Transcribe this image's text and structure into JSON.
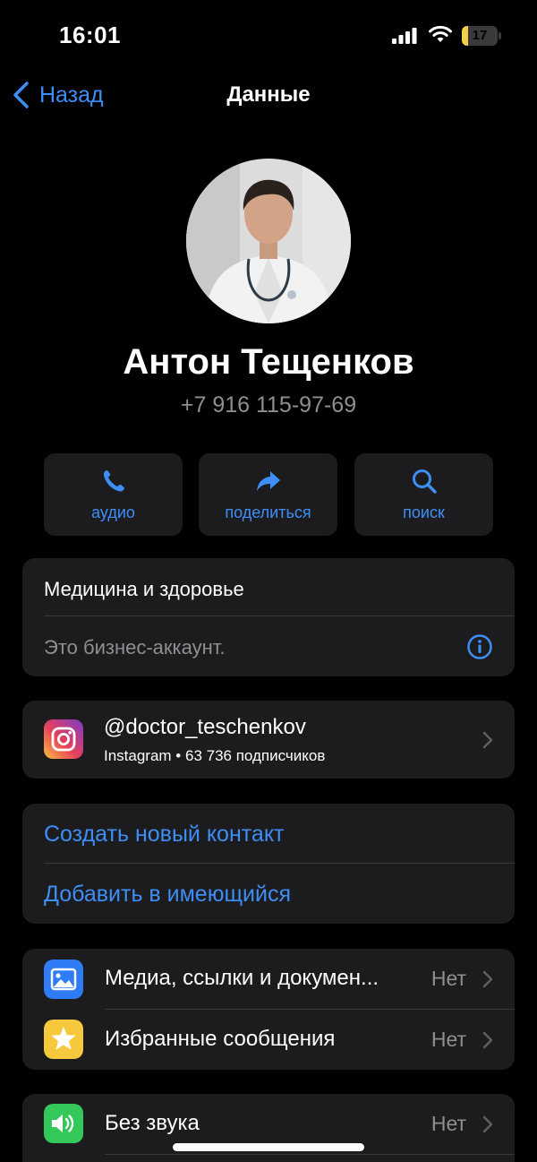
{
  "status_bar": {
    "time": "16:01",
    "battery_level": "17",
    "battery_fraction": 0.17
  },
  "nav": {
    "back_label": "Назад",
    "title": "Данные"
  },
  "profile": {
    "name": "Антон Тещенков",
    "phone": "+7 916 115-97-69"
  },
  "actions": [
    {
      "icon": "phone-icon",
      "label": "аудио"
    },
    {
      "icon": "share-arrow-icon",
      "label": "поделиться"
    },
    {
      "icon": "search-icon",
      "label": "поиск"
    }
  ],
  "business": {
    "category": "Медицина и здоровье",
    "note": "Это бизнес-аккаунт."
  },
  "instagram": {
    "handle": "@doctor_teschenkov",
    "meta": "Instagram • 63 736 подписчиков"
  },
  "contact_actions": {
    "create": "Создать новый контакт",
    "add_existing": "Добавить в имеющийся"
  },
  "media_section": {
    "media": {
      "label": "Медиа, ссылки и докумен...",
      "value": "Нет"
    },
    "starred": {
      "label": "Избранные сообщения",
      "value": "Нет"
    }
  },
  "mute_section": {
    "mute": {
      "label": "Без звука",
      "value": "Нет"
    }
  },
  "colors": {
    "accent": "#3e8ef7",
    "card": "#1c1c1e",
    "secondary_text": "#8e8e93"
  }
}
